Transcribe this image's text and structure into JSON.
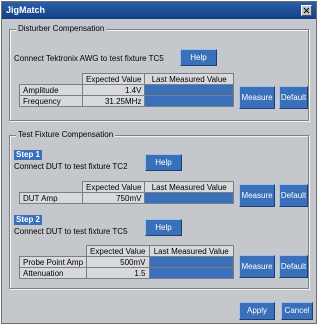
{
  "window": {
    "title": "JigMatch"
  },
  "disturber": {
    "legend": "Disturber Compensation",
    "instruction": "Connect Tektronix AWG to test fixture TC5",
    "help_label": "Help",
    "columns": [
      "Expected Value",
      "Last Measured Value"
    ],
    "rows": [
      {
        "label": "Amplitude",
        "expected": "1.4V",
        "last": ""
      },
      {
        "label": "Frequency",
        "expected": "31.25MHz",
        "last": ""
      }
    ],
    "measure_label": "Measure",
    "default_label": "Default"
  },
  "fixture": {
    "legend": "Test Fixture Compensation",
    "step1": {
      "tag": "Step 1",
      "instruction": "Connect DUT to test fixture TC2",
      "help_label": "Help",
      "columns": [
        "Expected Value",
        "Last Measured Value"
      ],
      "rows": [
        {
          "label": "DUT Amp",
          "expected": "750mV",
          "last": ""
        }
      ],
      "measure_label": "Measure",
      "default_label": "Default"
    },
    "step2": {
      "tag": "Step 2",
      "instruction": "Connect DUT to test fixture TC5",
      "help_label": "Help",
      "columns": [
        "Expected Value",
        "Last Measured Value"
      ],
      "rows": [
        {
          "label": "Probe Point Amp",
          "expected": "500mV",
          "last": ""
        },
        {
          "label": "Attenuation",
          "expected": "1.5",
          "last": ""
        }
      ],
      "measure_label": "Measure",
      "default_label": "Default"
    }
  },
  "footer": {
    "apply_label": "Apply",
    "cancel_label": "Cancel"
  },
  "colors": {
    "accent": "#3a6fba",
    "title_bar": "#1e4f98",
    "panel": "#c4c8cc"
  }
}
